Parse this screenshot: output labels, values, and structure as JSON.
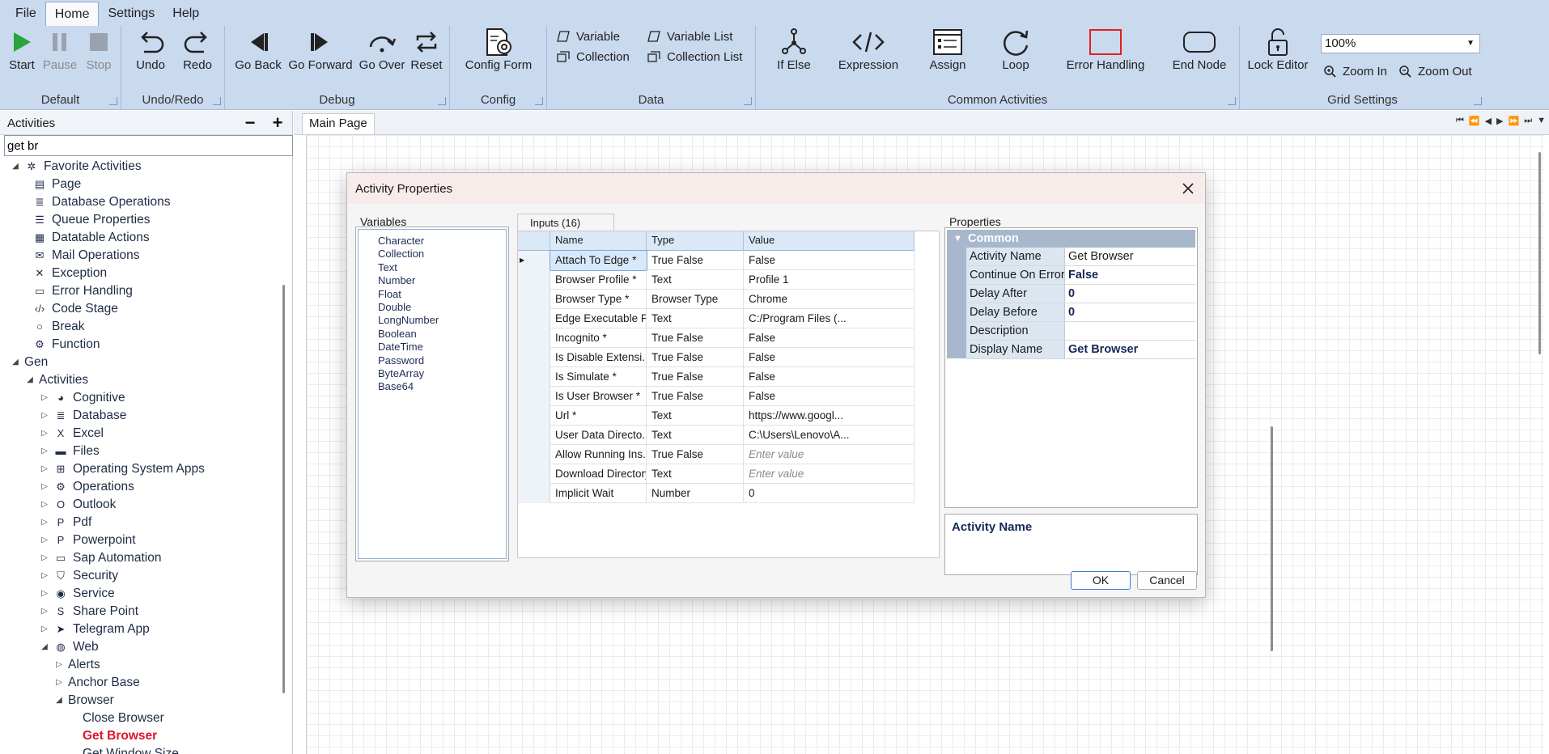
{
  "menu": [
    "File",
    "Home",
    "Settings",
    "Help"
  ],
  "ribbon": {
    "default": {
      "label": "Default",
      "start": "Start",
      "pause": "Pause",
      "stop": "Stop"
    },
    "undo_redo": {
      "label": "Undo/Redo",
      "undo": "Undo",
      "redo": "Redo"
    },
    "debug": {
      "label": "Debug",
      "go_back": "Go Back",
      "go_forward": "Go Forward",
      "go_over": "Go Over",
      "reset": "Reset"
    },
    "config": {
      "label": "Config",
      "config_form": "Config Form"
    },
    "data": {
      "label": "Data",
      "variable": "Variable",
      "variable_list": "Variable List",
      "collection": "Collection",
      "collection_list": "Collection List"
    },
    "common": {
      "label": "Common Activities",
      "if_else": "If Else",
      "expression": "Expression",
      "assign": "Assign",
      "loop": "Loop",
      "error_handling": "Error Handling",
      "end_node": "End Node"
    },
    "grid": {
      "label": "Grid Settings",
      "lock_editor": "Lock Editor",
      "zoom_value": "100%",
      "zoom_in": "Zoom In",
      "zoom_out": "Zoom Out"
    }
  },
  "left_panel": {
    "title": "Activities",
    "minus": "−",
    "plus": "+",
    "search_value": "get br"
  },
  "tree": [
    {
      "label": "Favorite Activities",
      "icon": "favorites-icon",
      "arrow": "◢"
    },
    {
      "label": "Page",
      "icon": "page-icon"
    },
    {
      "label": "Database Operations",
      "icon": "database-icon"
    },
    {
      "label": "Queue Properties",
      "icon": "queue-icon"
    },
    {
      "label": "Datatable Actions",
      "icon": "table-icon"
    },
    {
      "label": "Mail Operations",
      "icon": "mail-icon"
    },
    {
      "label": "Exception",
      "icon": "exception-icon"
    },
    {
      "label": "Error Handling",
      "icon": "error-handling-icon"
    },
    {
      "label": "Code Stage",
      "icon": "code-icon"
    },
    {
      "label": "Break",
      "icon": "break-icon"
    },
    {
      "label": "Function",
      "icon": "function-icon"
    },
    {
      "label": "Gen",
      "arrow": "◢"
    },
    {
      "label": "Activities",
      "arrow": "◢"
    },
    {
      "label": "Cognitive",
      "icon": "cognitive-icon",
      "arrow": "▷"
    },
    {
      "label": "Database",
      "icon": "database-icon",
      "arrow": "▷"
    },
    {
      "label": "Excel",
      "icon": "excel-icon",
      "arrow": "▷"
    },
    {
      "label": "Files",
      "icon": "folder-icon",
      "arrow": "▷"
    },
    {
      "label": "Operating System Apps",
      "icon": "windows-icon",
      "arrow": "▷"
    },
    {
      "label": "Operations",
      "icon": "operations-icon",
      "arrow": "▷"
    },
    {
      "label": "Outlook",
      "icon": "outlook-icon",
      "arrow": "▷"
    },
    {
      "label": "Pdf",
      "icon": "pdf-icon",
      "arrow": "▷"
    },
    {
      "label": "Powerpoint",
      "icon": "powerpoint-icon",
      "arrow": "▷"
    },
    {
      "label": "Sap Automation",
      "icon": "sap-icon",
      "arrow": "▷"
    },
    {
      "label": "Security",
      "icon": "security-icon",
      "arrow": "▷"
    },
    {
      "label": "Service",
      "icon": "service-icon",
      "arrow": "▷"
    },
    {
      "label": "Share Point",
      "icon": "sharepoint-icon",
      "arrow": "▷"
    },
    {
      "label": "Telegram App",
      "icon": "telegram-icon",
      "arrow": "▷"
    },
    {
      "label": "Web",
      "icon": "web-icon",
      "arrow": "◢"
    },
    {
      "label": "Alerts",
      "arrow": "▷"
    },
    {
      "label": "Anchor Base",
      "arrow": "▷"
    },
    {
      "label": "Browser",
      "arrow": "◢"
    },
    {
      "label": "Close Browser"
    },
    {
      "label": "Get Browser"
    },
    {
      "label": "Get Window Size"
    }
  ],
  "canvas": {
    "tab": "Main Page"
  },
  "dialog": {
    "title": "Activity Properties",
    "variables_label": "Variables",
    "variables": [
      "Character",
      "Collection",
      "Text",
      "Number",
      "Float",
      "Double",
      "LongNumber",
      "Boolean",
      "DateTime",
      "Password",
      "ByteArray",
      "Base64"
    ],
    "inputs_tab": "Inputs (16)",
    "columns": [
      "Name",
      "Type",
      "Value"
    ],
    "rows": [
      {
        "name": "Attach To Edge *",
        "type": "True False",
        "value": "False"
      },
      {
        "name": "Browser Profile *",
        "type": "Text",
        "value": "Profile 1"
      },
      {
        "name": "Browser Type *",
        "type": "Browser Type",
        "value": "Chrome"
      },
      {
        "name": "Edge Executable P...",
        "type": "Text",
        "value": "C:/Program Files (..."
      },
      {
        "name": "Incognito *",
        "type": "True False",
        "value": "False"
      },
      {
        "name": "Is Disable Extensi...",
        "type": "True False",
        "value": "False"
      },
      {
        "name": "Is Simulate *",
        "type": "True False",
        "value": "False"
      },
      {
        "name": "Is User Browser *",
        "type": "True False",
        "value": "False"
      },
      {
        "name": "Url *",
        "type": "Text",
        "value": "https://www.googl..."
      },
      {
        "name": "User Data Directo...",
        "type": "Text",
        "value": "C:\\Users\\Lenovo\\A..."
      },
      {
        "name": "Allow Running Ins...",
        "type": "True False",
        "value": "",
        "placeholder": "Enter value"
      },
      {
        "name": "Download Directory",
        "type": "Text",
        "value": "",
        "placeholder": "Enter value"
      },
      {
        "name": "Implicit Wait",
        "type": "Number",
        "value": "0"
      }
    ],
    "properties_label": "Properties",
    "category": "Common",
    "properties": [
      {
        "name": "Activity Name",
        "value": "Get Browser",
        "bold": false
      },
      {
        "name": "Continue On Error",
        "value": "False",
        "bold": true
      },
      {
        "name": "Delay After",
        "value": "0",
        "bold": true
      },
      {
        "name": "Delay Before",
        "value": "0",
        "bold": true
      },
      {
        "name": "Description",
        "value": "",
        "bold": false
      },
      {
        "name": "Display Name",
        "value": "Get Browser",
        "bold": true
      }
    ],
    "description_title": "Activity Name",
    "ok": "OK",
    "cancel": "Cancel"
  }
}
